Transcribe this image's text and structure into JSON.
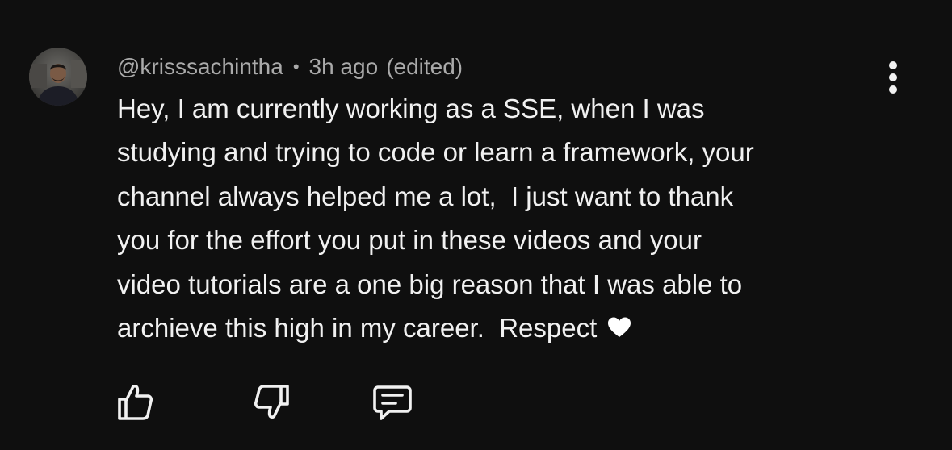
{
  "comment": {
    "author": "@krisssachintha",
    "separator": "•",
    "time": "3h ago",
    "edited": "(edited)",
    "lines": [
      "Hey, I am currently working as a SSE, when I was",
      "studying and trying to code or learn a framework, your",
      "channel always helped me a lot,  I just want to thank",
      "you for the effort you put in these videos and your",
      "video tutorials are a one big reason that I was able to",
      "archieve this high in my career.  Respect"
    ]
  },
  "icons": {
    "more": "more-vertical-icon",
    "like": "thumbs-up-icon",
    "dislike": "thumbs-down-icon",
    "reply": "reply-comment-icon",
    "heart": "heart-icon"
  },
  "colors": {
    "background": "#0f0f0f",
    "text": "#f1f1f1",
    "meta": "#aaaaaa"
  }
}
